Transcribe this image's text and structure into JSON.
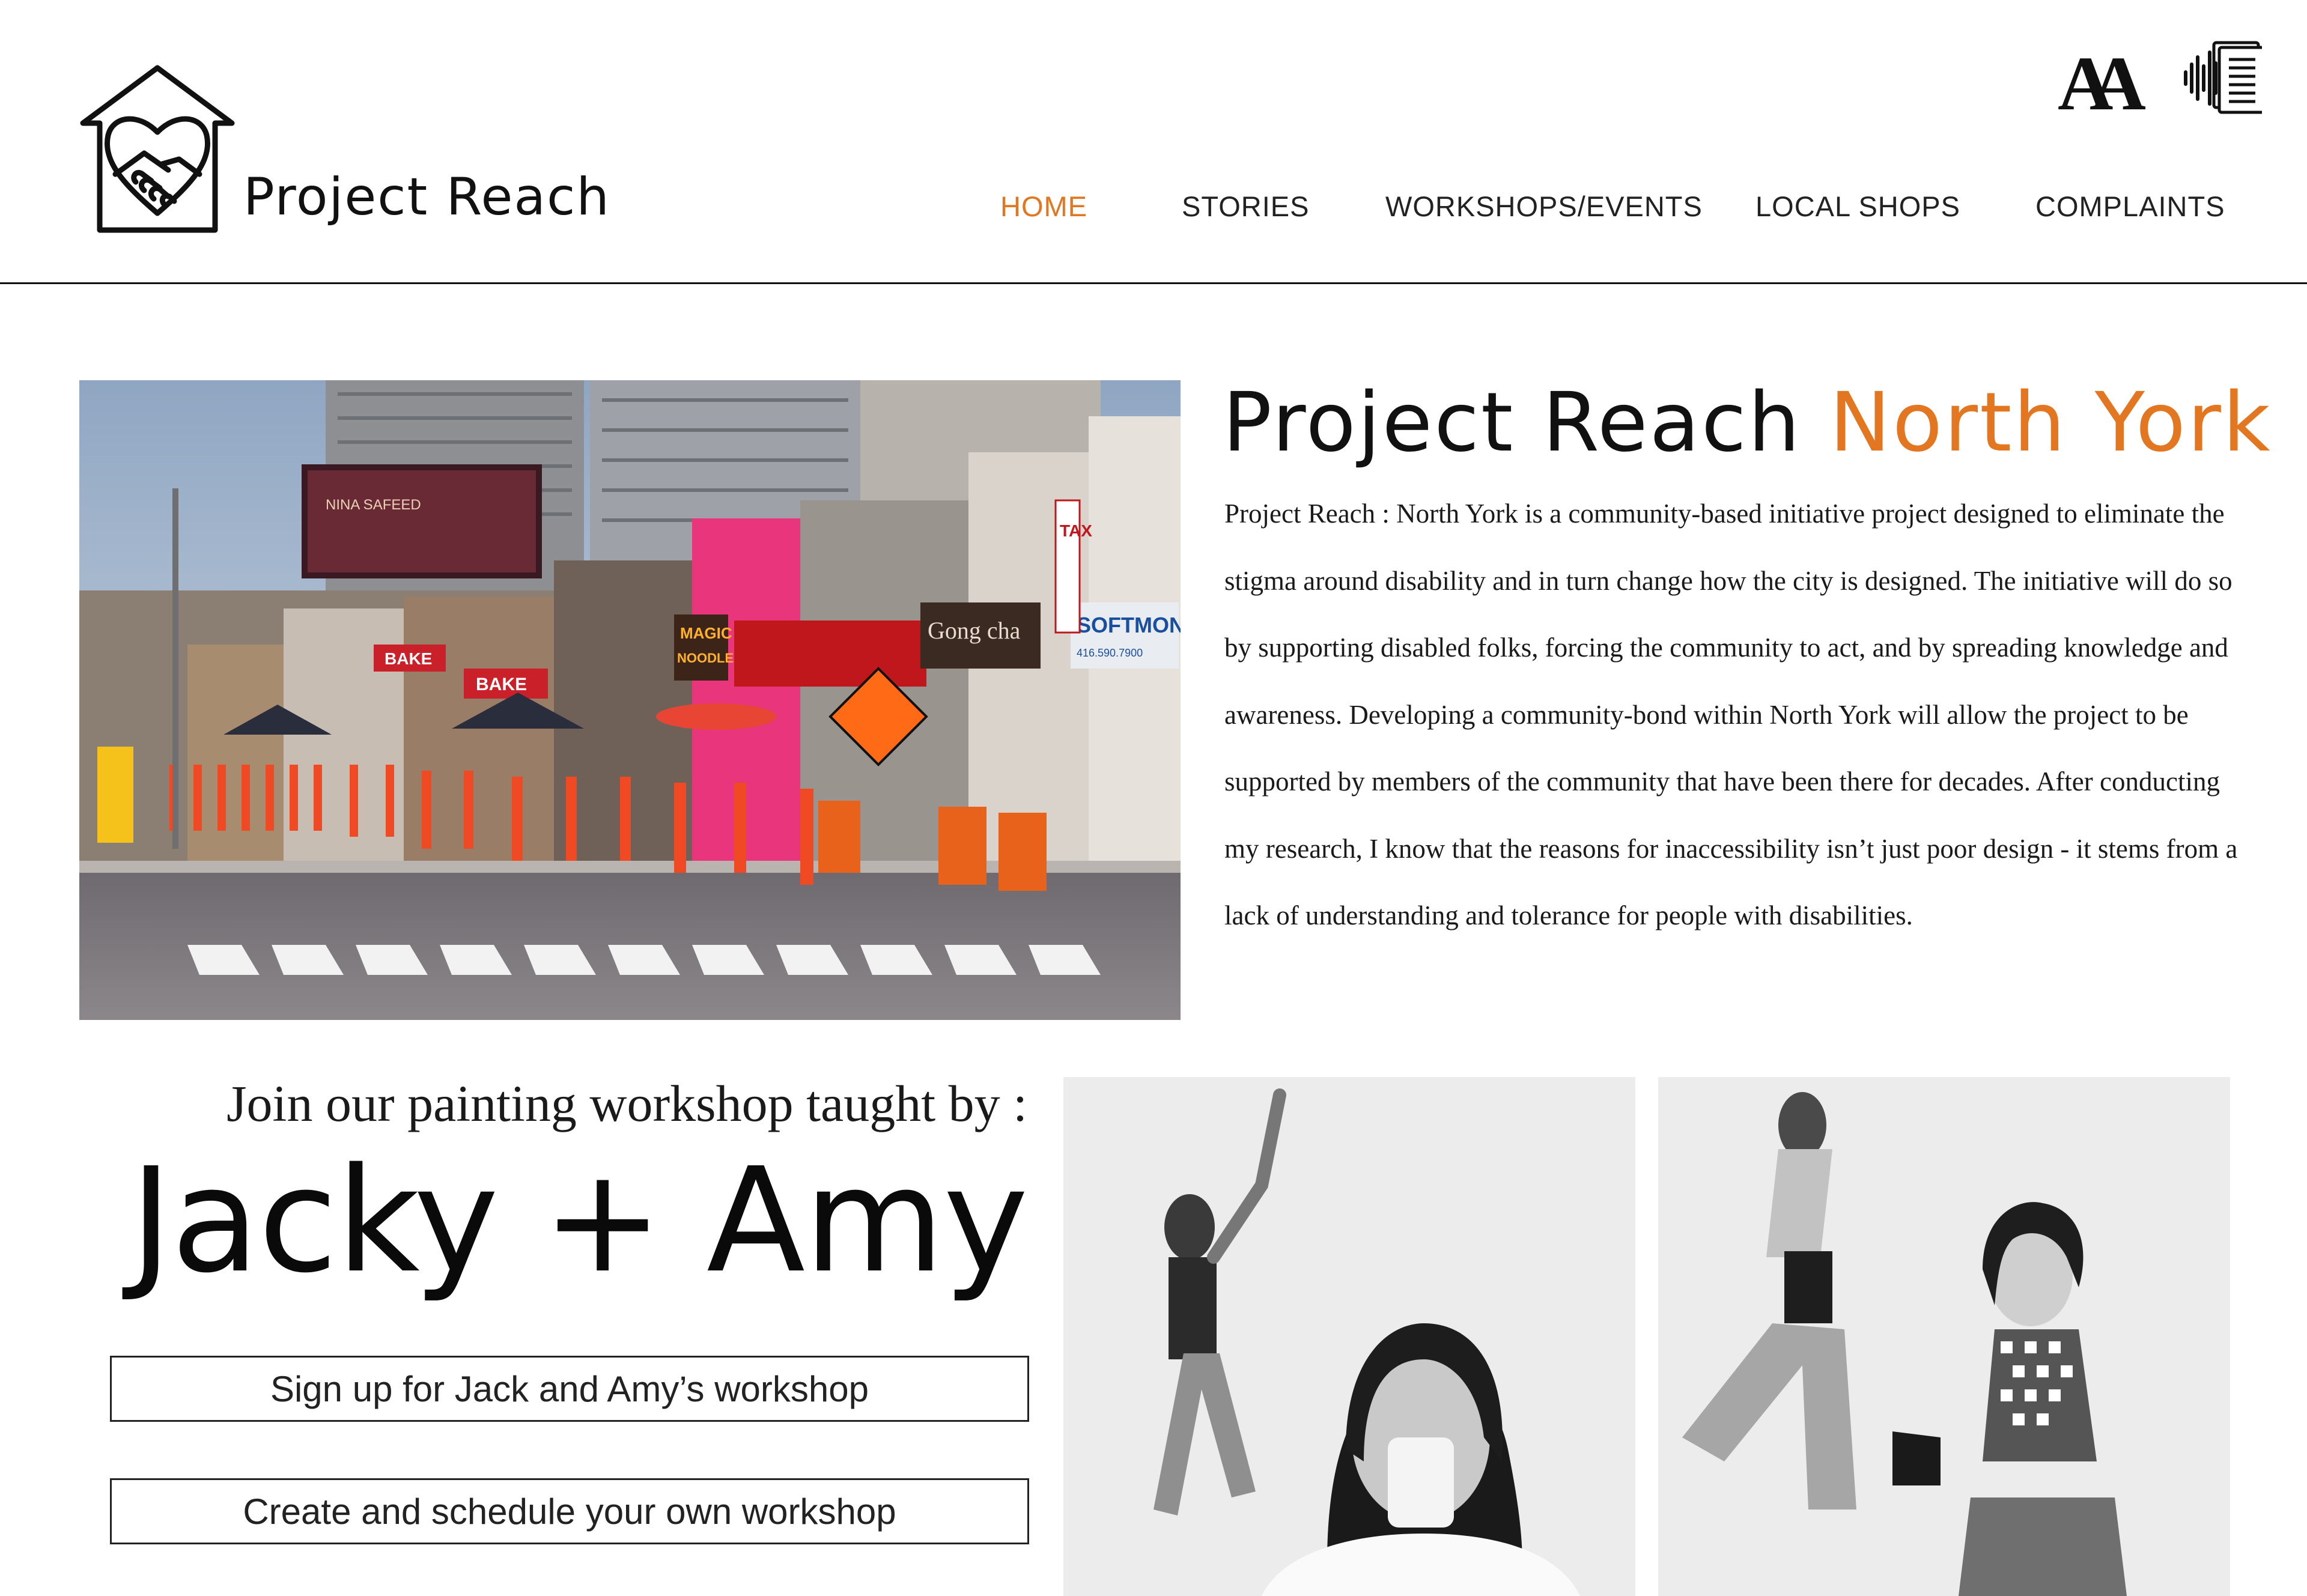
{
  "header": {
    "logo_text": "Project Reach",
    "font_size_glyph": "AA",
    "nav": [
      {
        "label": "HOME",
        "active": true
      },
      {
        "label": "STORIES",
        "active": false
      },
      {
        "label": "WORKSHOPS/EVENTS",
        "active": false
      },
      {
        "label": "LOCAL SHOPS",
        "active": false
      },
      {
        "label": "COMPLAINTS",
        "active": false
      }
    ]
  },
  "hero": {
    "title_main": "Project Reach",
    "title_accent": "North York",
    "body": "Project Reach : North York is a community-based initiative project designed to eliminate the stigma around disability and in turn change how the city is designed. The initiative will do so by supporting disabled folks, forcing the community to act, and by spreading knowledge and awareness. Developing a community-bond within North York will allow the project to be supported by members of the community that have been there for decades. After conducting my research, I know that the reasons for inaccessibility isn’t just poor design - it stems from a lack of understanding and tolerance for people with disabilities.",
    "photo_signs": {
      "nina": "NINA SAFEED",
      "bake1": "BAKE",
      "bake2": "BAKE",
      "magic": "MAGIC",
      "noodle": "NOODLE",
      "gongcha": "Gong cha",
      "softmon": "SOFTMON",
      "softmon_phone": "416.590.7900",
      "tax": "TAX"
    }
  },
  "workshop": {
    "intro": "Join our painting workshop taught by :",
    "name_a": "Jacky",
    "plus": "+",
    "name_b": "Amy",
    "signup_button": "Sign up for Jack and Amy’s workshop",
    "create_button": "Create and schedule your own workshop"
  },
  "colors": {
    "accent": "#e27621",
    "text": "#111111",
    "rule": "#111111"
  },
  "icons": {
    "logo": "house-handshake-icon",
    "font_size": "font-size-icon",
    "audio": "audio-reader-icon"
  }
}
